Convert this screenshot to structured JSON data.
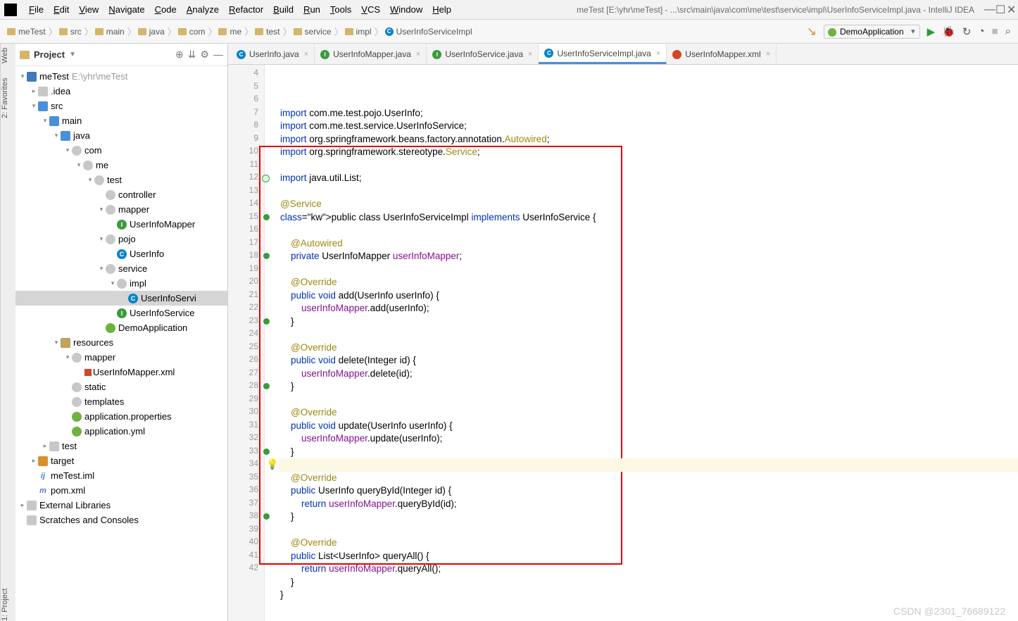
{
  "app": {
    "title": "meTest [E:\\yhr\\meTest] - ...\\src\\main\\java\\com\\me\\test\\service\\impl\\UserInfoServiceImpl.java - IntelliJ IDEA"
  },
  "menu": [
    "File",
    "Edit",
    "View",
    "Navigate",
    "Code",
    "Analyze",
    "Refactor",
    "Build",
    "Run",
    "Tools",
    "VCS",
    "Window",
    "Help"
  ],
  "breadcrumbs": [
    "meTest",
    "src",
    "main",
    "java",
    "com",
    "me",
    "test",
    "service",
    "impl",
    "UserInfoServiceImpl"
  ],
  "runConfig": "DemoApplication",
  "projectPanel": {
    "title": "Project",
    "rootName": "meTest",
    "rootPath": "E:\\yhr\\meTest"
  },
  "tree": [
    {
      "d": 0,
      "tw": "▾",
      "ico": "module",
      "label": "meTest",
      "dim": "E:\\yhr\\meTest"
    },
    {
      "d": 1,
      "tw": "▸",
      "ico": "folder grey",
      "label": ".idea"
    },
    {
      "d": 1,
      "tw": "▾",
      "ico": "folder src",
      "label": "src"
    },
    {
      "d": 2,
      "tw": "▾",
      "ico": "folder src",
      "label": "main"
    },
    {
      "d": 3,
      "tw": "▾",
      "ico": "folder src",
      "label": "java"
    },
    {
      "d": 4,
      "tw": "▾",
      "ico": "package",
      "label": "com"
    },
    {
      "d": 5,
      "tw": "▾",
      "ico": "package",
      "label": "me"
    },
    {
      "d": 6,
      "tw": "▾",
      "ico": "package",
      "label": "test"
    },
    {
      "d": 7,
      "tw": "",
      "ico": "package",
      "label": "controller"
    },
    {
      "d": 7,
      "tw": "▾",
      "ico": "package",
      "label": "mapper"
    },
    {
      "d": 8,
      "tw": "",
      "ico": "iface",
      "icotxt": "I",
      "label": "UserInfoMapper"
    },
    {
      "d": 7,
      "tw": "▾",
      "ico": "package",
      "label": "pojo"
    },
    {
      "d": 8,
      "tw": "",
      "ico": "cls",
      "icotxt": "C",
      "label": "UserInfo"
    },
    {
      "d": 7,
      "tw": "▾",
      "ico": "package",
      "label": "service"
    },
    {
      "d": 8,
      "tw": "▾",
      "ico": "package",
      "label": "impl"
    },
    {
      "d": 9,
      "tw": "",
      "ico": "cls",
      "icotxt": "C",
      "label": "UserInfoServi",
      "selected": true
    },
    {
      "d": 8,
      "tw": "",
      "ico": "iface",
      "icotxt": "I",
      "label": "UserInfoService"
    },
    {
      "d": 7,
      "tw": "",
      "ico": "spring",
      "label": "DemoApplication"
    },
    {
      "d": 3,
      "tw": "▾",
      "ico": "folder res",
      "label": "resources"
    },
    {
      "d": 4,
      "tw": "▾",
      "ico": "package",
      "label": "mapper"
    },
    {
      "d": 5,
      "tw": "",
      "ico": "xml",
      "label": "UserInfoMapper.xml"
    },
    {
      "d": 4,
      "tw": "",
      "ico": "package",
      "label": "static"
    },
    {
      "d": 4,
      "tw": "",
      "ico": "package",
      "label": "templates"
    },
    {
      "d": 4,
      "tw": "",
      "ico": "spring",
      "label": "application.properties"
    },
    {
      "d": 4,
      "tw": "",
      "ico": "spring",
      "label": "application.yml"
    },
    {
      "d": 2,
      "tw": "▸",
      "ico": "folder grey",
      "label": "test"
    },
    {
      "d": 1,
      "tw": "▸",
      "ico": "folder orange",
      "label": "target"
    },
    {
      "d": 1,
      "tw": "",
      "ico": "iml",
      "icotxt": "ij",
      "label": "meTest.iml"
    },
    {
      "d": 1,
      "tw": "",
      "ico": "iml",
      "icotxt": "m",
      "label": "pom.xml"
    },
    {
      "d": 0,
      "tw": "▸",
      "ico": "lib",
      "label": "External Libraries"
    },
    {
      "d": 0,
      "tw": "",
      "ico": "scratch",
      "label": "Scratches and Consoles"
    }
  ],
  "tabs": [
    {
      "icon": "cls",
      "label": "UserInfo.java"
    },
    {
      "icon": "iface",
      "label": "UserInfoMapper.java"
    },
    {
      "icon": "iface",
      "label": "UserInfoService.java"
    },
    {
      "icon": "cls",
      "label": "UserInfoServiceImpl.java",
      "active": true
    },
    {
      "icon": "xml",
      "label": "UserInfoMapper.xml"
    }
  ],
  "code": {
    "startLine": 4,
    "highlightLine": 34,
    "lines": [
      {
        "n": 4,
        "t": "import com.me.test.pojo.UserInfo;",
        "kw": [
          "import"
        ]
      },
      {
        "n": 5,
        "t": "import com.me.test.service.UserInfoService;",
        "kw": [
          "import"
        ]
      },
      {
        "n": 6,
        "t": "import org.springframework.beans.factory.annotation.Autowired;",
        "kw": [
          "import"
        ]
      },
      {
        "n": 7,
        "t": "import org.springframework.stereotype.Service;",
        "kw": [
          "import"
        ]
      },
      {
        "n": 8,
        "t": ""
      },
      {
        "n": 9,
        "t": "import java.util.List;",
        "kw": [
          "import"
        ]
      },
      {
        "n": 10,
        "t": ""
      },
      {
        "n": 11,
        "t": "@Service",
        "ann": true
      },
      {
        "n": 12,
        "t": "public class UserInfoServiceImpl implements UserInfoService {",
        "kw": [
          "public",
          "class",
          "implements"
        ],
        "mark": "impl"
      },
      {
        "n": 13,
        "t": ""
      },
      {
        "n": 14,
        "t": "    @Autowired",
        "ann": true
      },
      {
        "n": 15,
        "t": "    private UserInfoMapper userInfoMapper;",
        "kw": [
          "private"
        ],
        "fld": [
          "userInfoMapper"
        ],
        "mark": "over"
      },
      {
        "n": 16,
        "t": ""
      },
      {
        "n": 17,
        "t": "    @Override",
        "ann": true
      },
      {
        "n": 18,
        "t": "    public void add(UserInfo userInfo) {",
        "kw": [
          "public",
          "void"
        ],
        "mark": "over"
      },
      {
        "n": 19,
        "t": "        userInfoMapper.add(userInfo);",
        "fld": [
          "userInfoMapper"
        ]
      },
      {
        "n": 20,
        "t": "    }"
      },
      {
        "n": 21,
        "t": ""
      },
      {
        "n": 22,
        "t": "    @Override",
        "ann": true
      },
      {
        "n": 23,
        "t": "    public void delete(Integer id) {",
        "kw": [
          "public",
          "void"
        ],
        "mark": "over"
      },
      {
        "n": 24,
        "t": "        userInfoMapper.delete(id);",
        "fld": [
          "userInfoMapper"
        ]
      },
      {
        "n": 25,
        "t": "    }"
      },
      {
        "n": 26,
        "t": ""
      },
      {
        "n": 27,
        "t": "    @Override",
        "ann": true
      },
      {
        "n": 28,
        "t": "    public void update(UserInfo userInfo) {",
        "kw": [
          "public",
          "void"
        ],
        "mark": "over"
      },
      {
        "n": 29,
        "t": "        userInfoMapper.update(userInfo);",
        "fld": [
          "userInfoMapper"
        ]
      },
      {
        "n": 30,
        "t": "    }"
      },
      {
        "n": 31,
        "t": ""
      },
      {
        "n": 32,
        "t": "    @Override",
        "ann": true
      },
      {
        "n": 33,
        "t": "    public UserInfo queryById(Integer id) {",
        "kw": [
          "public"
        ],
        "mark": "over"
      },
      {
        "n": 34,
        "t": "        return userInfoMapper.queryById(id);",
        "kw": [
          "return"
        ],
        "fld": [
          "userInfoMapper"
        ]
      },
      {
        "n": 35,
        "t": "    }"
      },
      {
        "n": 36,
        "t": ""
      },
      {
        "n": 37,
        "t": "    @Override",
        "ann": true
      },
      {
        "n": 38,
        "t": "    public List<UserInfo> queryAll() {",
        "kw": [
          "public"
        ],
        "mark": "over"
      },
      {
        "n": 39,
        "t": "        return userInfoMapper.queryAll();",
        "kw": [
          "return"
        ],
        "fld": [
          "userInfoMapper"
        ]
      },
      {
        "n": 40,
        "t": "    }"
      },
      {
        "n": 41,
        "t": "}"
      },
      {
        "n": 42,
        "t": ""
      }
    ]
  },
  "leftStrips": [
    "1: Project",
    "2: Favorites",
    "Web"
  ],
  "watermark": "CSDN @2301_76689122"
}
